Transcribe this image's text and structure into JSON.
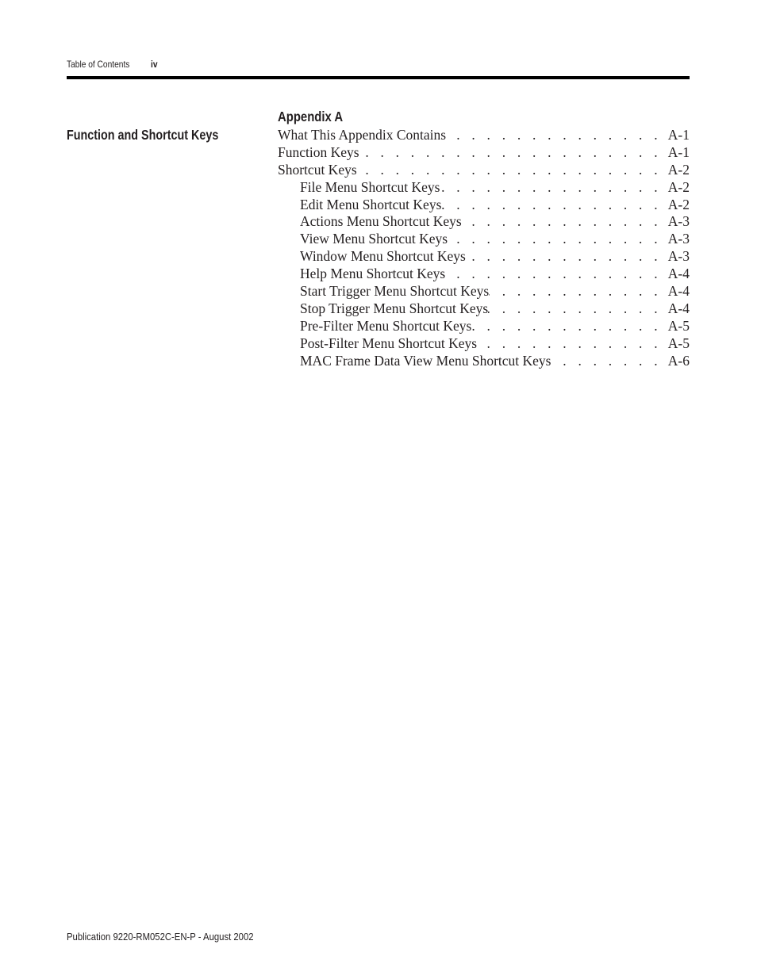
{
  "header": {
    "section": "Table of Contents",
    "page_number": "iv"
  },
  "side_heading": "Function and Shortcut Keys",
  "toc": {
    "title": "Appendix A",
    "leader": ". . . . . . . . . . . . . . . . . . . . . . . . . . . . . . . . . . . . . . . . . . . . . . . . . . .",
    "entries": [
      {
        "label": "What This Appendix Contains",
        "page": "A-1",
        "level": 1
      },
      {
        "label": "Function Keys",
        "page": "A-1",
        "level": 1
      },
      {
        "label": "Shortcut Keys",
        "page": "A-2",
        "level": 1
      },
      {
        "label": "File Menu Shortcut Keys",
        "page": "A-2",
        "level": 2
      },
      {
        "label": "Edit Menu Shortcut Keys",
        "page": "A-2",
        "level": 2
      },
      {
        "label": "Actions Menu Shortcut Keys",
        "page": "A-3",
        "level": 2
      },
      {
        "label": "View Menu Shortcut Keys",
        "page": "A-3",
        "level": 2
      },
      {
        "label": "Window Menu Shortcut Keys",
        "page": "A-3",
        "level": 2
      },
      {
        "label": "Help Menu Shortcut Keys",
        "page": "A-4",
        "level": 2
      },
      {
        "label": "Start Trigger Menu Shortcut Keys",
        "page": "A-4",
        "level": 2
      },
      {
        "label": "Stop Trigger Menu Shortcut Keys",
        "page": "A-4",
        "level": 2
      },
      {
        "label": "Pre-Filter Menu Shortcut Keys",
        "page": "A-5",
        "level": 2
      },
      {
        "label": "Post-Filter Menu Shortcut Keys",
        "page": "A-5",
        "level": 2
      },
      {
        "label": "MAC Frame Data View Menu Shortcut Keys",
        "page": "A-6",
        "level": 2
      }
    ]
  },
  "footer": {
    "publication": "Publication 9220-RM052C-EN-P - August 2002"
  }
}
